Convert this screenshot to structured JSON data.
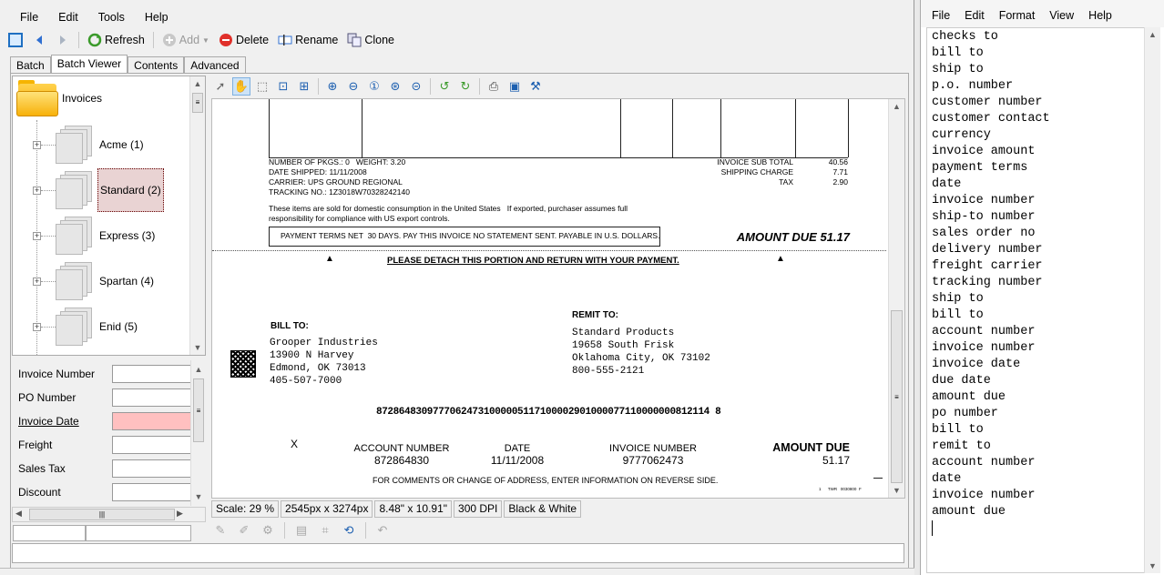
{
  "menu": [
    "File",
    "Edit",
    "Tools",
    "Help"
  ],
  "toolbar": {
    "refresh": "Refresh",
    "add": "Add",
    "delete": "Delete",
    "rename": "Rename",
    "clone": "Clone"
  },
  "tabs": [
    "Batch",
    "Batch Viewer",
    "Contents",
    "Advanced"
  ],
  "tree": {
    "root": "Invoices",
    "items": [
      {
        "label": "Acme (1)"
      },
      {
        "label": "Standard (2)"
      },
      {
        "label": "Express (3)"
      },
      {
        "label": "Spartan (4)"
      },
      {
        "label": "Enid (5)"
      }
    ]
  },
  "fields": [
    {
      "label": "Invoice Number",
      "value": ""
    },
    {
      "label": "PO Number",
      "value": ""
    },
    {
      "label": "Invoice Date",
      "value": ""
    },
    {
      "label": "Freight",
      "value": ""
    },
    {
      "label": "Sales Tax",
      "value": ""
    },
    {
      "label": "Discount",
      "value": ""
    }
  ],
  "status": {
    "scale": "Scale: 29 %",
    "pixels": "2545px x 3274px",
    "inches": "8.48\" x 10.91\"",
    "dpi": "300 DPI",
    "color": "Black & White"
  },
  "document": {
    "left_info": [
      "NUMBER OF PKGS.: 0   WEIGHT: 3.20",
      "DATE SHIPPED: 11/11/2008",
      "CARRIER: UPS GROUND REGIONAL",
      "TRACKING NO.: 1Z3018W70328242140"
    ],
    "right_labels": [
      "INVOICE SUB TOTAL",
      "SHIPPING CHARGE",
      "TAX"
    ],
    "right_values": [
      "40.56",
      "7.71",
      "2.90"
    ],
    "notice": [
      "These items are sold for domestic consumption in the United States   If exported, purchaser assumes full",
      "responsibility for compliance with US export controls."
    ],
    "terms": "PAYMENT TERMS NET  30 DAYS. PAY THIS INVOICE NO STATEMENT SENT. PAYABLE IN U.S. DOLLARS.",
    "amount_due_banner": "AMOUNT DUE 51.17",
    "detach": "PLEASE DETACH THIS PORTION AND RETURN WITH YOUR PAYMENT.",
    "bill_to_label": "BILL TO:",
    "bill_to": [
      "Grooper Industries",
      "13900 N Harvey",
      "Edmond, OK 73013",
      "405-507-7000"
    ],
    "remit_to_label": "REMIT TO:",
    "remit_to": [
      "Standard Products",
      "19658 South Frisk",
      "Oklahoma City, OK 73102",
      "800-555-2121"
    ],
    "micr": "87286483097770624731000005117100002901000077110000000812114 8",
    "x_mark": "X",
    "account_number_label": "ACCOUNT NUMBER",
    "account_number": "872864830",
    "date_label": "DATE",
    "date": "11/11/2008",
    "invoice_number_label": "INVOICE NUMBER",
    "invoice_number": "9777062473",
    "amount_due_label": "AMOUNT DUE",
    "amount_due": "51.17",
    "footer": "FOR COMMENTS OR CHANGE OF ADDRESS, ENTER INFORMATION ON REVERSE SIDE.",
    "footer_small": "1      TWR   0030800  F"
  },
  "notepad": {
    "menu": [
      "File",
      "Edit",
      "Format",
      "View",
      "Help"
    ],
    "lines": [
      "checks to",
      "bill to",
      "ship to",
      "p.o. number",
      "customer number",
      "customer contact",
      "currency",
      "invoice amount",
      "payment terms",
      "date",
      "invoice number",
      "ship-to number",
      "sales order no",
      "delivery number",
      "freight carrier",
      "tracking number",
      "ship to",
      "bill to",
      "account number",
      "invoice number",
      "invoice date",
      "due date",
      "amount due",
      "po number",
      "bill to",
      "remit to",
      "account number",
      "date",
      "invoice number",
      "amount due"
    ]
  }
}
